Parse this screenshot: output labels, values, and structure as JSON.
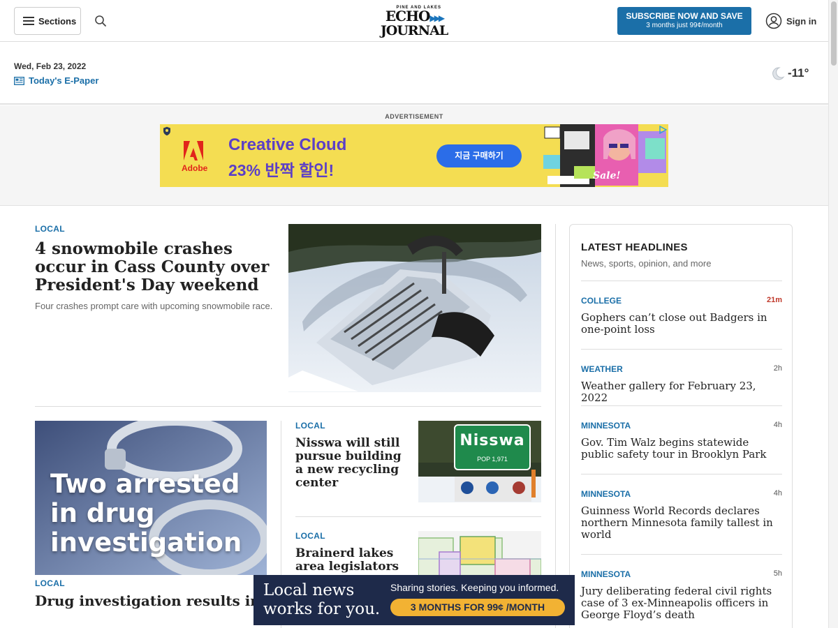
{
  "header": {
    "sections_label": "Sections",
    "logo": {
      "small": "PINE AND LAKES",
      "line1": "ECHO",
      "line2": "JOURNAL"
    },
    "subscribe": {
      "line1": "SUBSCRIBE NOW AND SAVE",
      "line2": "3 months just 99¢/month"
    },
    "signin_label": "Sign in"
  },
  "dateline": {
    "date": "Wed, Feb 23, 2022",
    "epaper_label": "Today's E-Paper",
    "temperature": "-11°"
  },
  "advertisement": {
    "label": "ADVERTISEMENT",
    "brand": "Adobe",
    "headline": "Creative Cloud",
    "offer": "23% 반짝 할인!",
    "button": "지금 구매하기",
    "sale_text": "Sale!"
  },
  "lead_story": {
    "kicker": "LOCAL",
    "title": "4 snowmobile crashes occur in Cass County over President's Day weekend",
    "summary": "Four crashes prompt care with upcoming snowmobile race."
  },
  "drug_story": {
    "image_text": [
      "Two arrested",
      "in drug",
      "investigation"
    ],
    "kicker": "LOCAL",
    "title": "Drug investigation results in arrest and drugs seized in Backus"
  },
  "nisswa_story": {
    "kicker": "LOCAL",
    "title": "Nisswa will still pursue building a new recycling center",
    "sign_name": "Nisswa",
    "sign_pop": "POP 1,971"
  },
  "brainerd_story": {
    "kicker": "LOCAL",
    "title": "Brainerd lakes area legislators"
  },
  "sidebar": {
    "title": "LATEST HEADLINES",
    "subtitle": "News, sports, opinion, and more",
    "items": [
      {
        "category": "COLLEGE",
        "time": "21m",
        "headline": "Gophers can’t close out Badgers in one-point loss"
      },
      {
        "category": "WEATHER",
        "time": "2h",
        "headline": "Weather gallery for February 23, 2022"
      },
      {
        "category": "MINNESOTA",
        "time": "4h",
        "headline": "Gov. Tim Walz begins statewide public safety tour in Brooklyn Park"
      },
      {
        "category": "MINNESOTA",
        "time": "4h",
        "headline": "Guinness World Records declares northern Minnesota family tallest in world"
      },
      {
        "category": "MINNESOTA",
        "time": "5h",
        "headline": "Jury deliberating federal civil rights case of 3 ex-Minneapolis officers in George Floyd’s death"
      }
    ]
  },
  "promo": {
    "line1": "Local news",
    "line2": "works for you.",
    "tagline": "Sharing stories. Keeping you informed.",
    "cta": "3 MONTHS FOR 99¢ /MONTH"
  },
  "colors": {
    "brand_blue": "#1b6fa8",
    "ad_yellow": "#f4dd52",
    "promo_navy": "#1e2a4a",
    "promo_cta": "#f2b233"
  }
}
